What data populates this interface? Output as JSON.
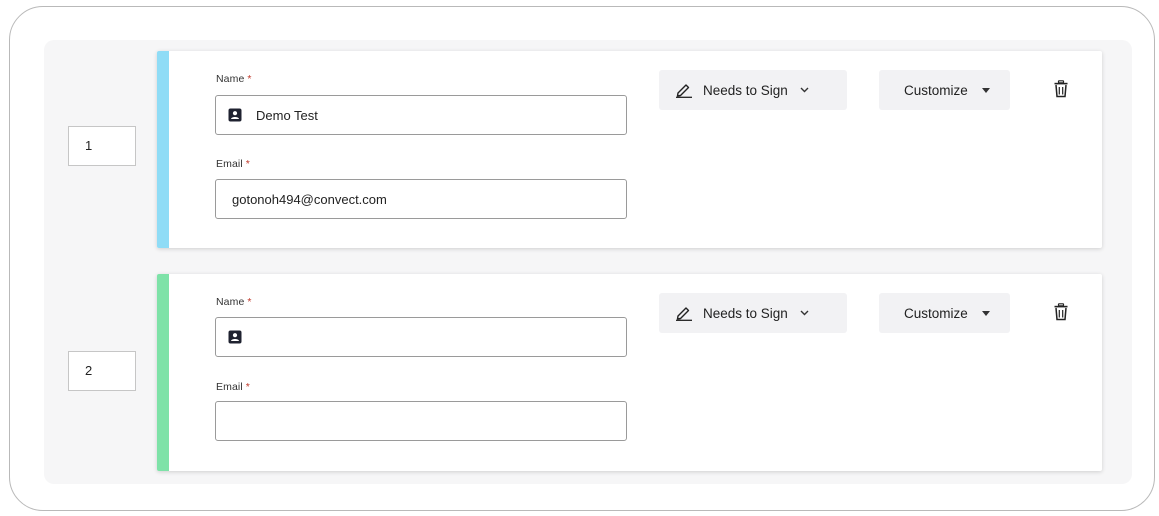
{
  "signers": [
    {
      "order": "1",
      "accent_color": "#8fdcf6",
      "name_label": "Name",
      "name_value": "Demo Test",
      "email_label": "Email",
      "email_value": "gotonoh494@convect.com",
      "required_mark": "*",
      "role_label": "Needs to Sign",
      "customize_label": "Customize",
      "icons": {
        "contact": "contact-card-icon",
        "role": "pen-icon",
        "delete": "trash-icon"
      }
    },
    {
      "order": "2",
      "accent_color": "#7ee2a8",
      "name_label": "Name",
      "name_value": "",
      "email_label": "Email",
      "email_value": "",
      "required_mark": "*",
      "role_label": "Needs to Sign",
      "customize_label": "Customize",
      "icons": {
        "contact": "contact-card-icon",
        "role": "pen-icon",
        "delete": "trash-icon"
      }
    }
  ],
  "colors": {
    "required": "#c0392b",
    "panel_background": "#f6f6f7",
    "pill_background": "#f2f2f4"
  }
}
